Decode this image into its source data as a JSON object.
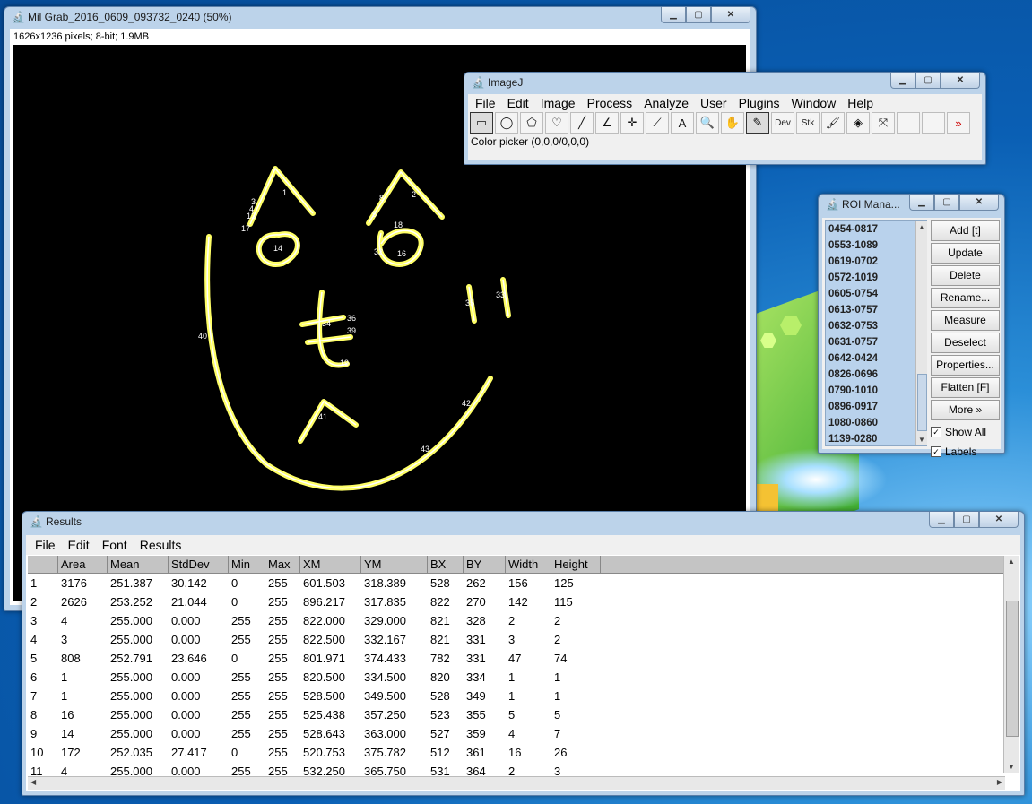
{
  "image_window": {
    "title": "Mil Grab_2016_0609_093732_0240 (50%)",
    "info": "1626x1236 pixels; 8-bit; 1.9MB",
    "roi_labels": [
      "1",
      "2",
      "8",
      "5",
      "18",
      "16",
      "14",
      "17",
      "13",
      "4",
      "3",
      "32",
      "33",
      "35",
      "34",
      "36",
      "39",
      "40",
      "19",
      "41",
      "42",
      "43"
    ]
  },
  "imagej": {
    "title": "ImageJ",
    "menus": [
      "File",
      "Edit",
      "Image",
      "Process",
      "Analyze",
      "User",
      "Plugins",
      "Window",
      "Help"
    ],
    "tools": {
      "dev": "Dev",
      "stk": "Stk",
      "more": "»"
    },
    "status": "Color picker (0,0,0/0,0,0)"
  },
  "roi_manager": {
    "title": "ROI Mana...",
    "items": [
      "0454-0817",
      "0553-1089",
      "0619-0702",
      "0572-1019",
      "0605-0754",
      "0613-0757",
      "0632-0753",
      "0631-0757",
      "0642-0424",
      "0826-0696",
      "0790-1010",
      "0896-0917",
      "1080-0860",
      "1139-0280"
    ],
    "buttons": [
      "Add [t]",
      "Update",
      "Delete",
      "Rename...",
      "Measure",
      "Deselect",
      "Properties...",
      "Flatten [F]",
      "More »"
    ],
    "show_all": "Show All",
    "labels": "Labels"
  },
  "results": {
    "title": "Results",
    "menus": [
      "File",
      "Edit",
      "Font",
      "Results"
    ],
    "columns": [
      "",
      "Area",
      "Mean",
      "StdDev",
      "Min",
      "Max",
      "XM",
      "YM",
      "BX",
      "BY",
      "Width",
      "Height"
    ],
    "rows": [
      [
        "1",
        "3176",
        "251.387",
        "30.142",
        "0",
        "255",
        "601.503",
        "318.389",
        "528",
        "262",
        "156",
        "125"
      ],
      [
        "2",
        "2626",
        "253.252",
        "21.044",
        "0",
        "255",
        "896.217",
        "317.835",
        "822",
        "270",
        "142",
        "115"
      ],
      [
        "3",
        "4",
        "255.000",
        "0.000",
        "255",
        "255",
        "822.000",
        "329.000",
        "821",
        "328",
        "2",
        "2"
      ],
      [
        "4",
        "3",
        "255.000",
        "0.000",
        "255",
        "255",
        "822.500",
        "332.167",
        "821",
        "331",
        "3",
        "2"
      ],
      [
        "5",
        "808",
        "252.791",
        "23.646",
        "0",
        "255",
        "801.971",
        "374.433",
        "782",
        "331",
        "47",
        "74"
      ],
      [
        "6",
        "1",
        "255.000",
        "0.000",
        "255",
        "255",
        "820.500",
        "334.500",
        "820",
        "334",
        "1",
        "1"
      ],
      [
        "7",
        "1",
        "255.000",
        "0.000",
        "255",
        "255",
        "528.500",
        "349.500",
        "528",
        "349",
        "1",
        "1"
      ],
      [
        "8",
        "16",
        "255.000",
        "0.000",
        "255",
        "255",
        "525.438",
        "357.250",
        "523",
        "355",
        "5",
        "5"
      ],
      [
        "9",
        "14",
        "255.000",
        "0.000",
        "255",
        "255",
        "528.643",
        "363.000",
        "527",
        "359",
        "4",
        "7"
      ],
      [
        "10",
        "172",
        "252.035",
        "27.417",
        "0",
        "255",
        "520.753",
        "375.782",
        "512",
        "361",
        "16",
        "26"
      ],
      [
        "11",
        "4",
        "255.000",
        "0.000",
        "255",
        "255",
        "532.250",
        "365.750",
        "531",
        "364",
        "2",
        "3"
      ]
    ]
  }
}
